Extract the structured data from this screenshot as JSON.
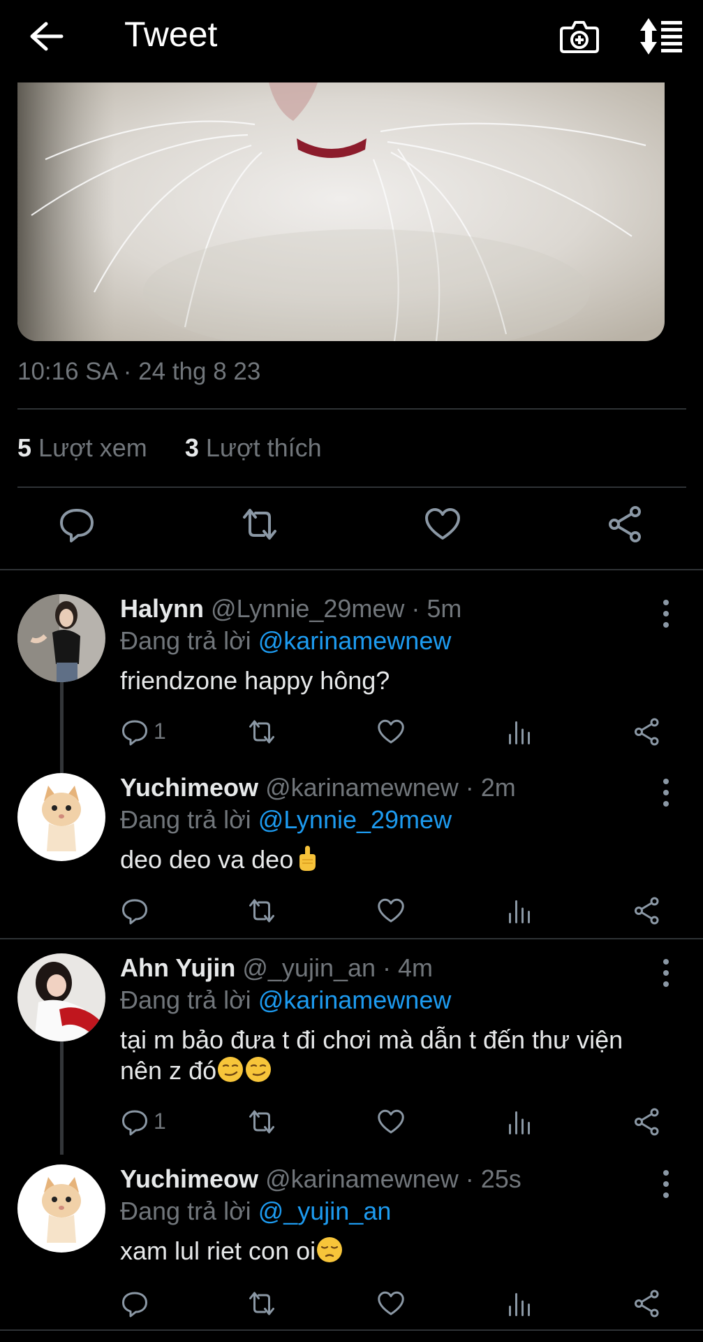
{
  "header": {
    "title": "Tweet"
  },
  "tweet": {
    "timestamp": "10:16 SA · 24 thg 8 23",
    "views_count": "5",
    "views_label": "Lượt xem",
    "likes_count": "3",
    "likes_label": "Lượt thích"
  },
  "replies": [
    {
      "name": "Halynn",
      "handle": "@Lynnie_29mew · 5m",
      "replying_label": "Đang trả lời",
      "replying_to": "@karinamewnew",
      "text": "friendzone happy hông?",
      "reply_count": "1"
    },
    {
      "name": "Yuchimeow",
      "handle": "@karinamewnew · 2m",
      "replying_label": "Đang trả lời",
      "replying_to": "@Lynnie_29mew",
      "text": "deo deo va deo",
      "reply_count": ""
    },
    {
      "name": "Ahn Yujin",
      "handle": "@_yujin_an · 4m",
      "replying_label": "Đang trả lời",
      "replying_to": "@karinamewnew",
      "text_line1": "tại m bảo đưa t đi chơi mà dẫn t đến thư viện",
      "text_line2": "nên z đó",
      "reply_count": "1"
    },
    {
      "name": "Yuchimeow",
      "handle": "@karinamewnew · 25s",
      "replying_label": "Đang trả lời",
      "replying_to": "@_yujin_an",
      "text": "xam lul riet con oi",
      "reply_count": ""
    }
  ],
  "colors": {
    "accent": "#1d9bf0",
    "muted": "#71767b",
    "background": "#000000"
  }
}
